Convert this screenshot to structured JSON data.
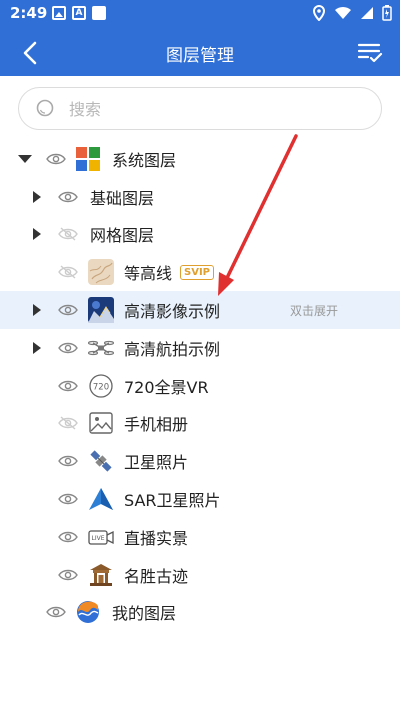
{
  "status_bar": {
    "time": "2:49",
    "a_icon": "A"
  },
  "app_bar": {
    "title": "图层管理"
  },
  "search": {
    "placeholder": "搜索"
  },
  "tree": {
    "root": "系统图层",
    "items": [
      {
        "label": "基础图层"
      },
      {
        "label": "网格图层"
      },
      {
        "label": "等高线",
        "badge": "SVIP"
      },
      {
        "label": "高清影像示例",
        "hint": "双击展开"
      },
      {
        "label": "高清航拍示例"
      },
      {
        "label": "720全景VR"
      },
      {
        "label": "手机相册"
      },
      {
        "label": "卫星照片"
      },
      {
        "label": "SAR卫星照片"
      },
      {
        "label": "直播实景"
      },
      {
        "label": "名胜古迹"
      }
    ],
    "my_layers": "我的图层"
  },
  "colors": {
    "primary": "#2f6fd6",
    "highlight": "#e8f1fc",
    "annotation_arrow": "#e03030",
    "svip": "#e0a030"
  }
}
